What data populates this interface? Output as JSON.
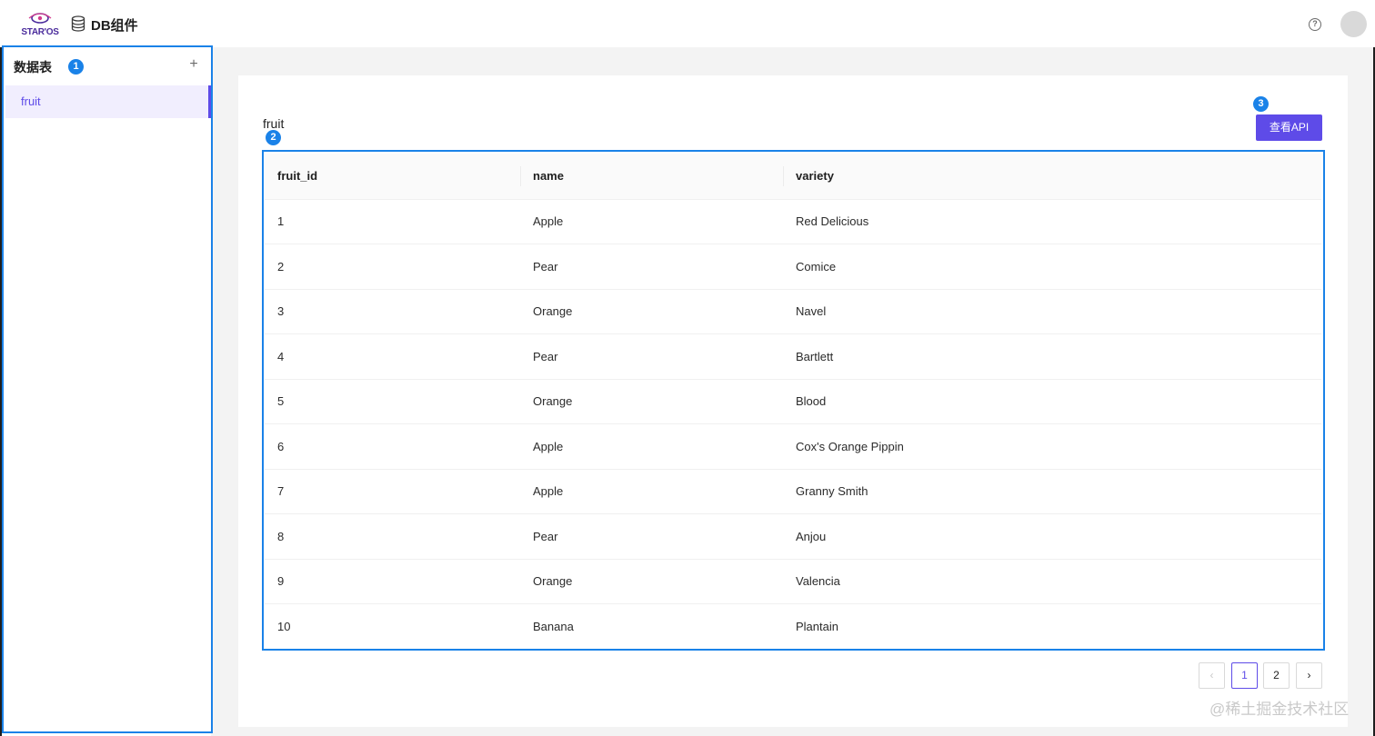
{
  "header": {
    "logo_text": "STAR'OS",
    "app_title": "DB组件",
    "help_glyph": "?"
  },
  "sidebar": {
    "title": "数据表",
    "add_glyph": "+",
    "items": [
      {
        "label": "fruit",
        "selected": true
      }
    ]
  },
  "annotations": [
    "1",
    "2",
    "3"
  ],
  "main": {
    "table_title": "fruit",
    "api_button_label": "查看API",
    "table": {
      "columns": [
        "fruit_id",
        "name",
        "variety"
      ],
      "rows": [
        [
          "1",
          "Apple",
          "Red Delicious"
        ],
        [
          "2",
          "Pear",
          "Comice"
        ],
        [
          "3",
          "Orange",
          "Navel"
        ],
        [
          "4",
          "Pear",
          "Bartlett"
        ],
        [
          "5",
          "Orange",
          "Blood"
        ],
        [
          "6",
          "Apple",
          "Cox's Orange Pippin"
        ],
        [
          "7",
          "Apple",
          "Granny Smith"
        ],
        [
          "8",
          "Pear",
          "Anjou"
        ],
        [
          "9",
          "Orange",
          "Valencia"
        ],
        [
          "10",
          "Banana",
          "Plantain"
        ]
      ]
    },
    "pagination": {
      "prev_glyph": "‹",
      "next_glyph": "›",
      "pages": [
        "1",
        "2"
      ],
      "current_page": "1"
    }
  },
  "watermark": "@稀土掘金技术社区",
  "colors": {
    "accent": "#5e4be8",
    "annotation": "#1a82e8",
    "background": "#f3f3f3"
  }
}
